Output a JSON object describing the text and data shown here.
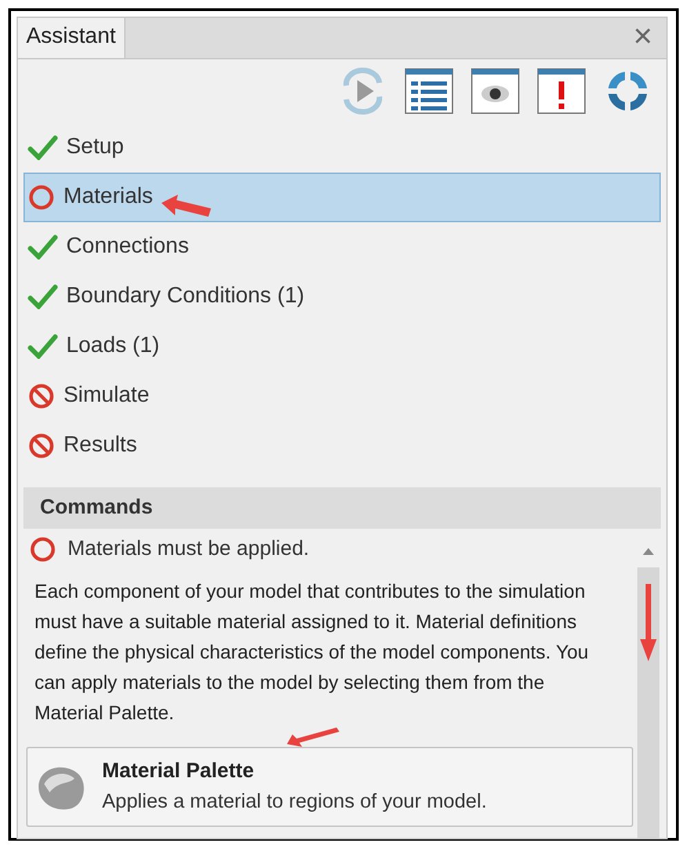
{
  "panel": {
    "tab": "Assistant",
    "close": "×"
  },
  "steps": [
    {
      "label": "Setup",
      "kind": "done",
      "selected": false
    },
    {
      "label": "Materials",
      "kind": "pending",
      "selected": true
    },
    {
      "label": "Connections",
      "kind": "done",
      "selected": false
    },
    {
      "label": "Boundary Conditions (1)",
      "kind": "done",
      "selected": false
    },
    {
      "label": "Loads (1)",
      "kind": "done",
      "selected": false
    },
    {
      "label": "Simulate",
      "kind": "blocked",
      "selected": false
    },
    {
      "label": "Results",
      "kind": "blocked",
      "selected": false
    }
  ],
  "commands": {
    "header": "Commands",
    "message": {
      "kind": "pending",
      "text": "Materials must be applied."
    },
    "description": "Each component of your model that contributes to the simulation must have a suitable material assigned to it. Material definitions define the physical characteristics of the model components. You can apply materials to the model by selecting them from the Material Palette.",
    "command": {
      "title": "Material Palette",
      "subtitle": "Applies a material to regions of your model."
    }
  }
}
